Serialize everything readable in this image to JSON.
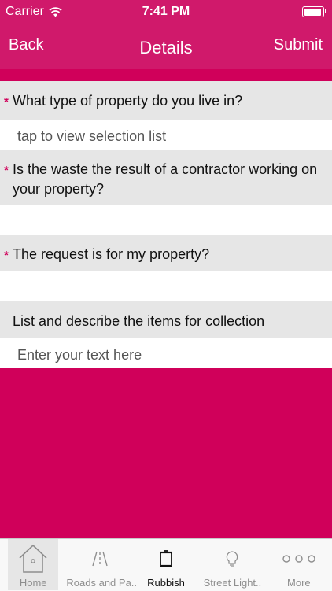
{
  "status_bar": {
    "carrier": "Carrier",
    "time": "7:41 PM"
  },
  "nav": {
    "back_label": "Back",
    "title": "Details",
    "submit_label": "Submit"
  },
  "form": {
    "fields": [
      {
        "required_mark": "*",
        "question": "What type of property do you live in?",
        "answer": "tap to view selection list"
      },
      {
        "required_mark": "*",
        "question": "Is the waste the result of a contractor working on your property?",
        "answer": ""
      },
      {
        "required_mark": "*",
        "question": "The request is for my property?",
        "answer": ""
      },
      {
        "question": "List and describe the items for collection",
        "answer": "Enter your text here"
      }
    ]
  },
  "tabbar": {
    "tabs": [
      {
        "label": "Home",
        "icon": "house-icon"
      },
      {
        "label": "Roads and Pa..",
        "icon": "road-icon"
      },
      {
        "label": "Rubbish",
        "icon": "bin-icon"
      },
      {
        "label": "Street Light..",
        "icon": "lightbulb-icon"
      },
      {
        "label": "More",
        "icon": "more-dots-icon"
      }
    ],
    "active": "Rubbish"
  },
  "colors": {
    "brand": "#d0196b",
    "background": "#d0005a",
    "question_bg": "#e6e6e6",
    "answer_bg": "#ffffff",
    "required": "#d0005a"
  }
}
